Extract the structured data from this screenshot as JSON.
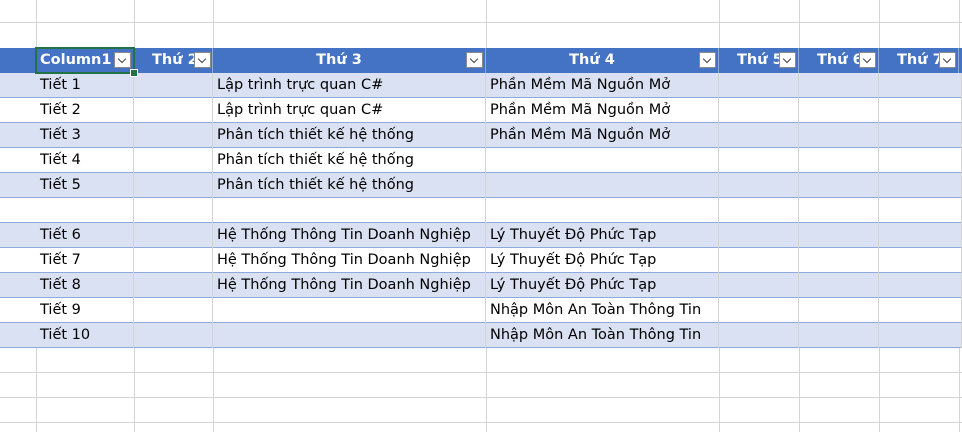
{
  "headers": [
    {
      "label": "Column1"
    },
    {
      "label": "Thứ 2"
    },
    {
      "label": "Thứ 3"
    },
    {
      "label": "Thứ 4"
    },
    {
      "label": "Thứ 5"
    },
    {
      "label": "Thứ 6"
    },
    {
      "label": "Thứ 7"
    }
  ],
  "rows": [
    [
      "Tiết 1",
      "",
      "Lập trình trực quan C#",
      "Phần Mềm Mã Nguồn Mở",
      "",
      "",
      ""
    ],
    [
      "Tiết 2",
      "",
      "Lập trình trực quan C#",
      "Phần Mềm Mã Nguồn Mở",
      "",
      "",
      ""
    ],
    [
      "Tiết 3",
      "",
      "Phân tích thiết kế hệ thống",
      "Phần Mềm Mã Nguồn Mở",
      "",
      "",
      ""
    ],
    [
      "Tiết 4",
      "",
      "Phân tích thiết kế hệ thống",
      "",
      "",
      "",
      ""
    ],
    [
      "Tiết 5",
      "",
      "Phân tích thiết kế hệ thống",
      "",
      "",
      "",
      ""
    ],
    [
      "",
      "",
      "",
      "",
      "",
      "",
      ""
    ],
    [
      "Tiết 6",
      "",
      "Hệ Thống Thông Tin Doanh Nghiệp",
      "Lý Thuyết Độ Phức Tạp",
      "",
      "",
      ""
    ],
    [
      "Tiết 7",
      "",
      "Hệ Thống Thông Tin Doanh Nghiệp",
      "Lý Thuyết Độ Phức Tạp",
      "",
      "",
      ""
    ],
    [
      "Tiết 8",
      "",
      "Hệ Thống Thông Tin Doanh Nghiệp",
      "Lý Thuyết Độ Phức Tạp",
      "",
      "",
      ""
    ],
    [
      "Tiết 9",
      "",
      "",
      "Nhập Môn An Toàn Thông Tin",
      "",
      "",
      ""
    ],
    [
      "Tiết 10",
      "",
      "",
      "Nhập Môn An Toàn Thông Tin",
      "",
      "",
      ""
    ]
  ],
  "colors": {
    "header": "#4472c4",
    "band": "#d9e1f2",
    "grid": "#d4d4d4",
    "selection": "#217346"
  }
}
